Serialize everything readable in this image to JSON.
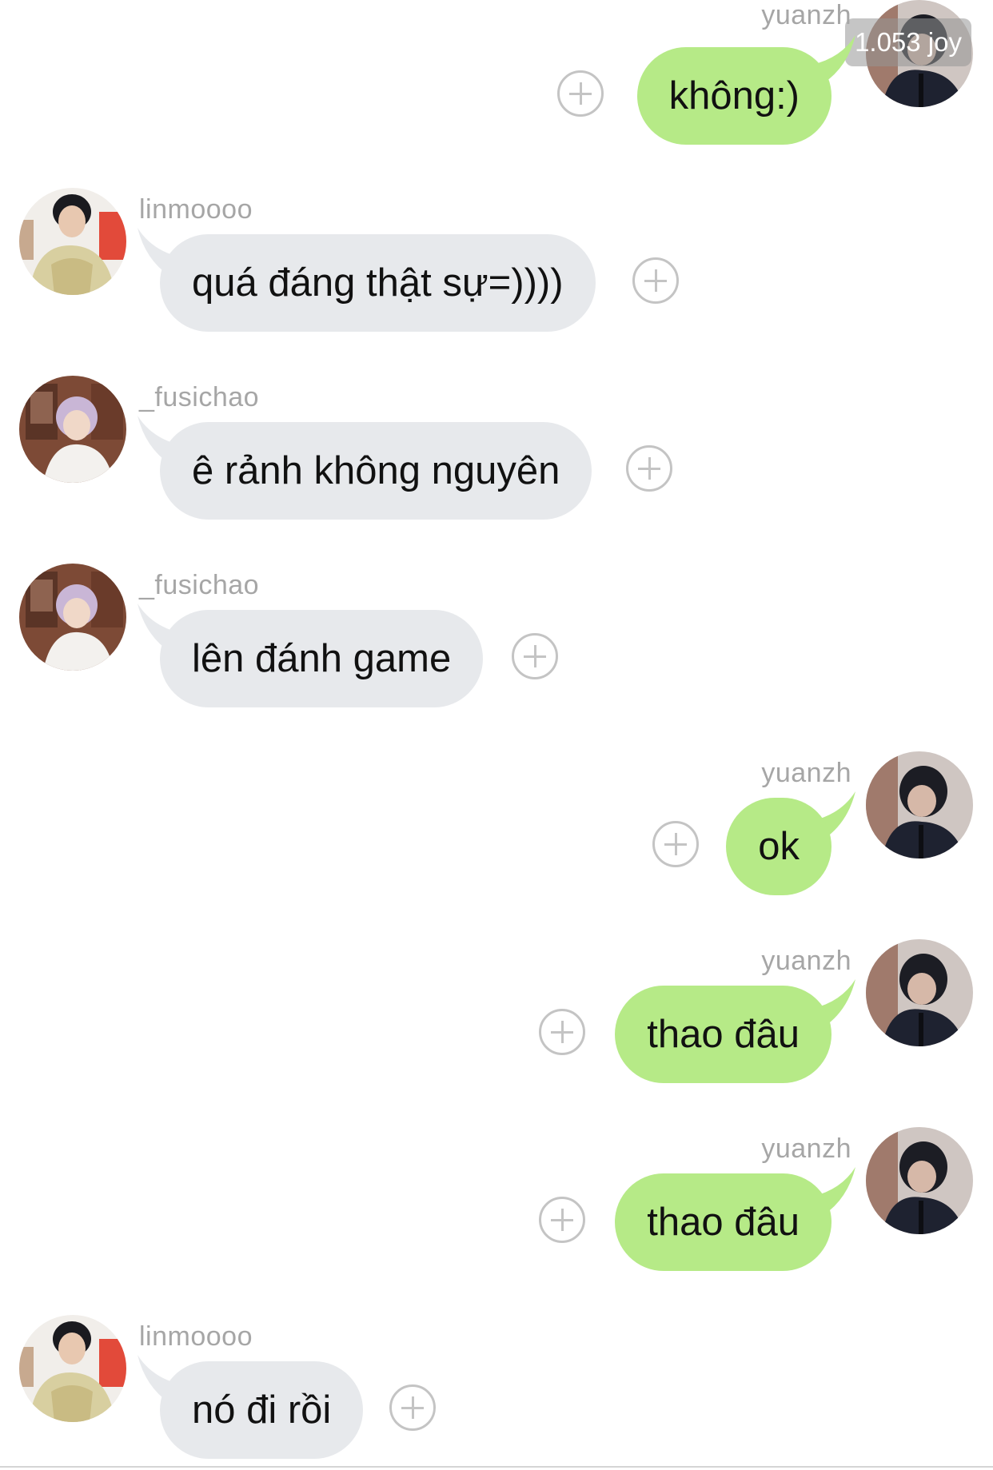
{
  "counter": "1.053 joy",
  "messages": [
    {
      "sender": "yuanzh",
      "text": "không:)",
      "side": "right",
      "avatar": "avatar-yuanzh"
    },
    {
      "sender": "linmoooo",
      "text": "quá đáng thật sự=))))",
      "side": "left",
      "avatar": "avatar-linmoooo"
    },
    {
      "sender": "_fusichao",
      "text": "ê rảnh không nguyên",
      "side": "left",
      "avatar": "avatar-fusichao"
    },
    {
      "sender": "_fusichao",
      "text": "lên đánh game",
      "side": "left",
      "avatar": "avatar-fusichao"
    },
    {
      "sender": "yuanzh",
      "text": "ok",
      "side": "right",
      "avatar": "avatar-yuanzh"
    },
    {
      "sender": "yuanzh",
      "text": "thao đâu",
      "side": "right",
      "avatar": "avatar-yuanzh"
    },
    {
      "sender": "yuanzh",
      "text": "thao đâu",
      "side": "right",
      "avatar": "avatar-yuanzh"
    },
    {
      "sender": "linmoooo",
      "text": "nó đi rồi",
      "side": "left",
      "avatar": "avatar-linmoooo"
    }
  ],
  "colors": {
    "outgoing_bubble": "#b6ea87",
    "incoming_bubble": "#e7e9ec",
    "sender_text": "#a6a6a6",
    "message_text": "#111111",
    "plus_icon": "#c4c4c4"
  },
  "icons": {
    "react": "plus-circle-icon"
  }
}
